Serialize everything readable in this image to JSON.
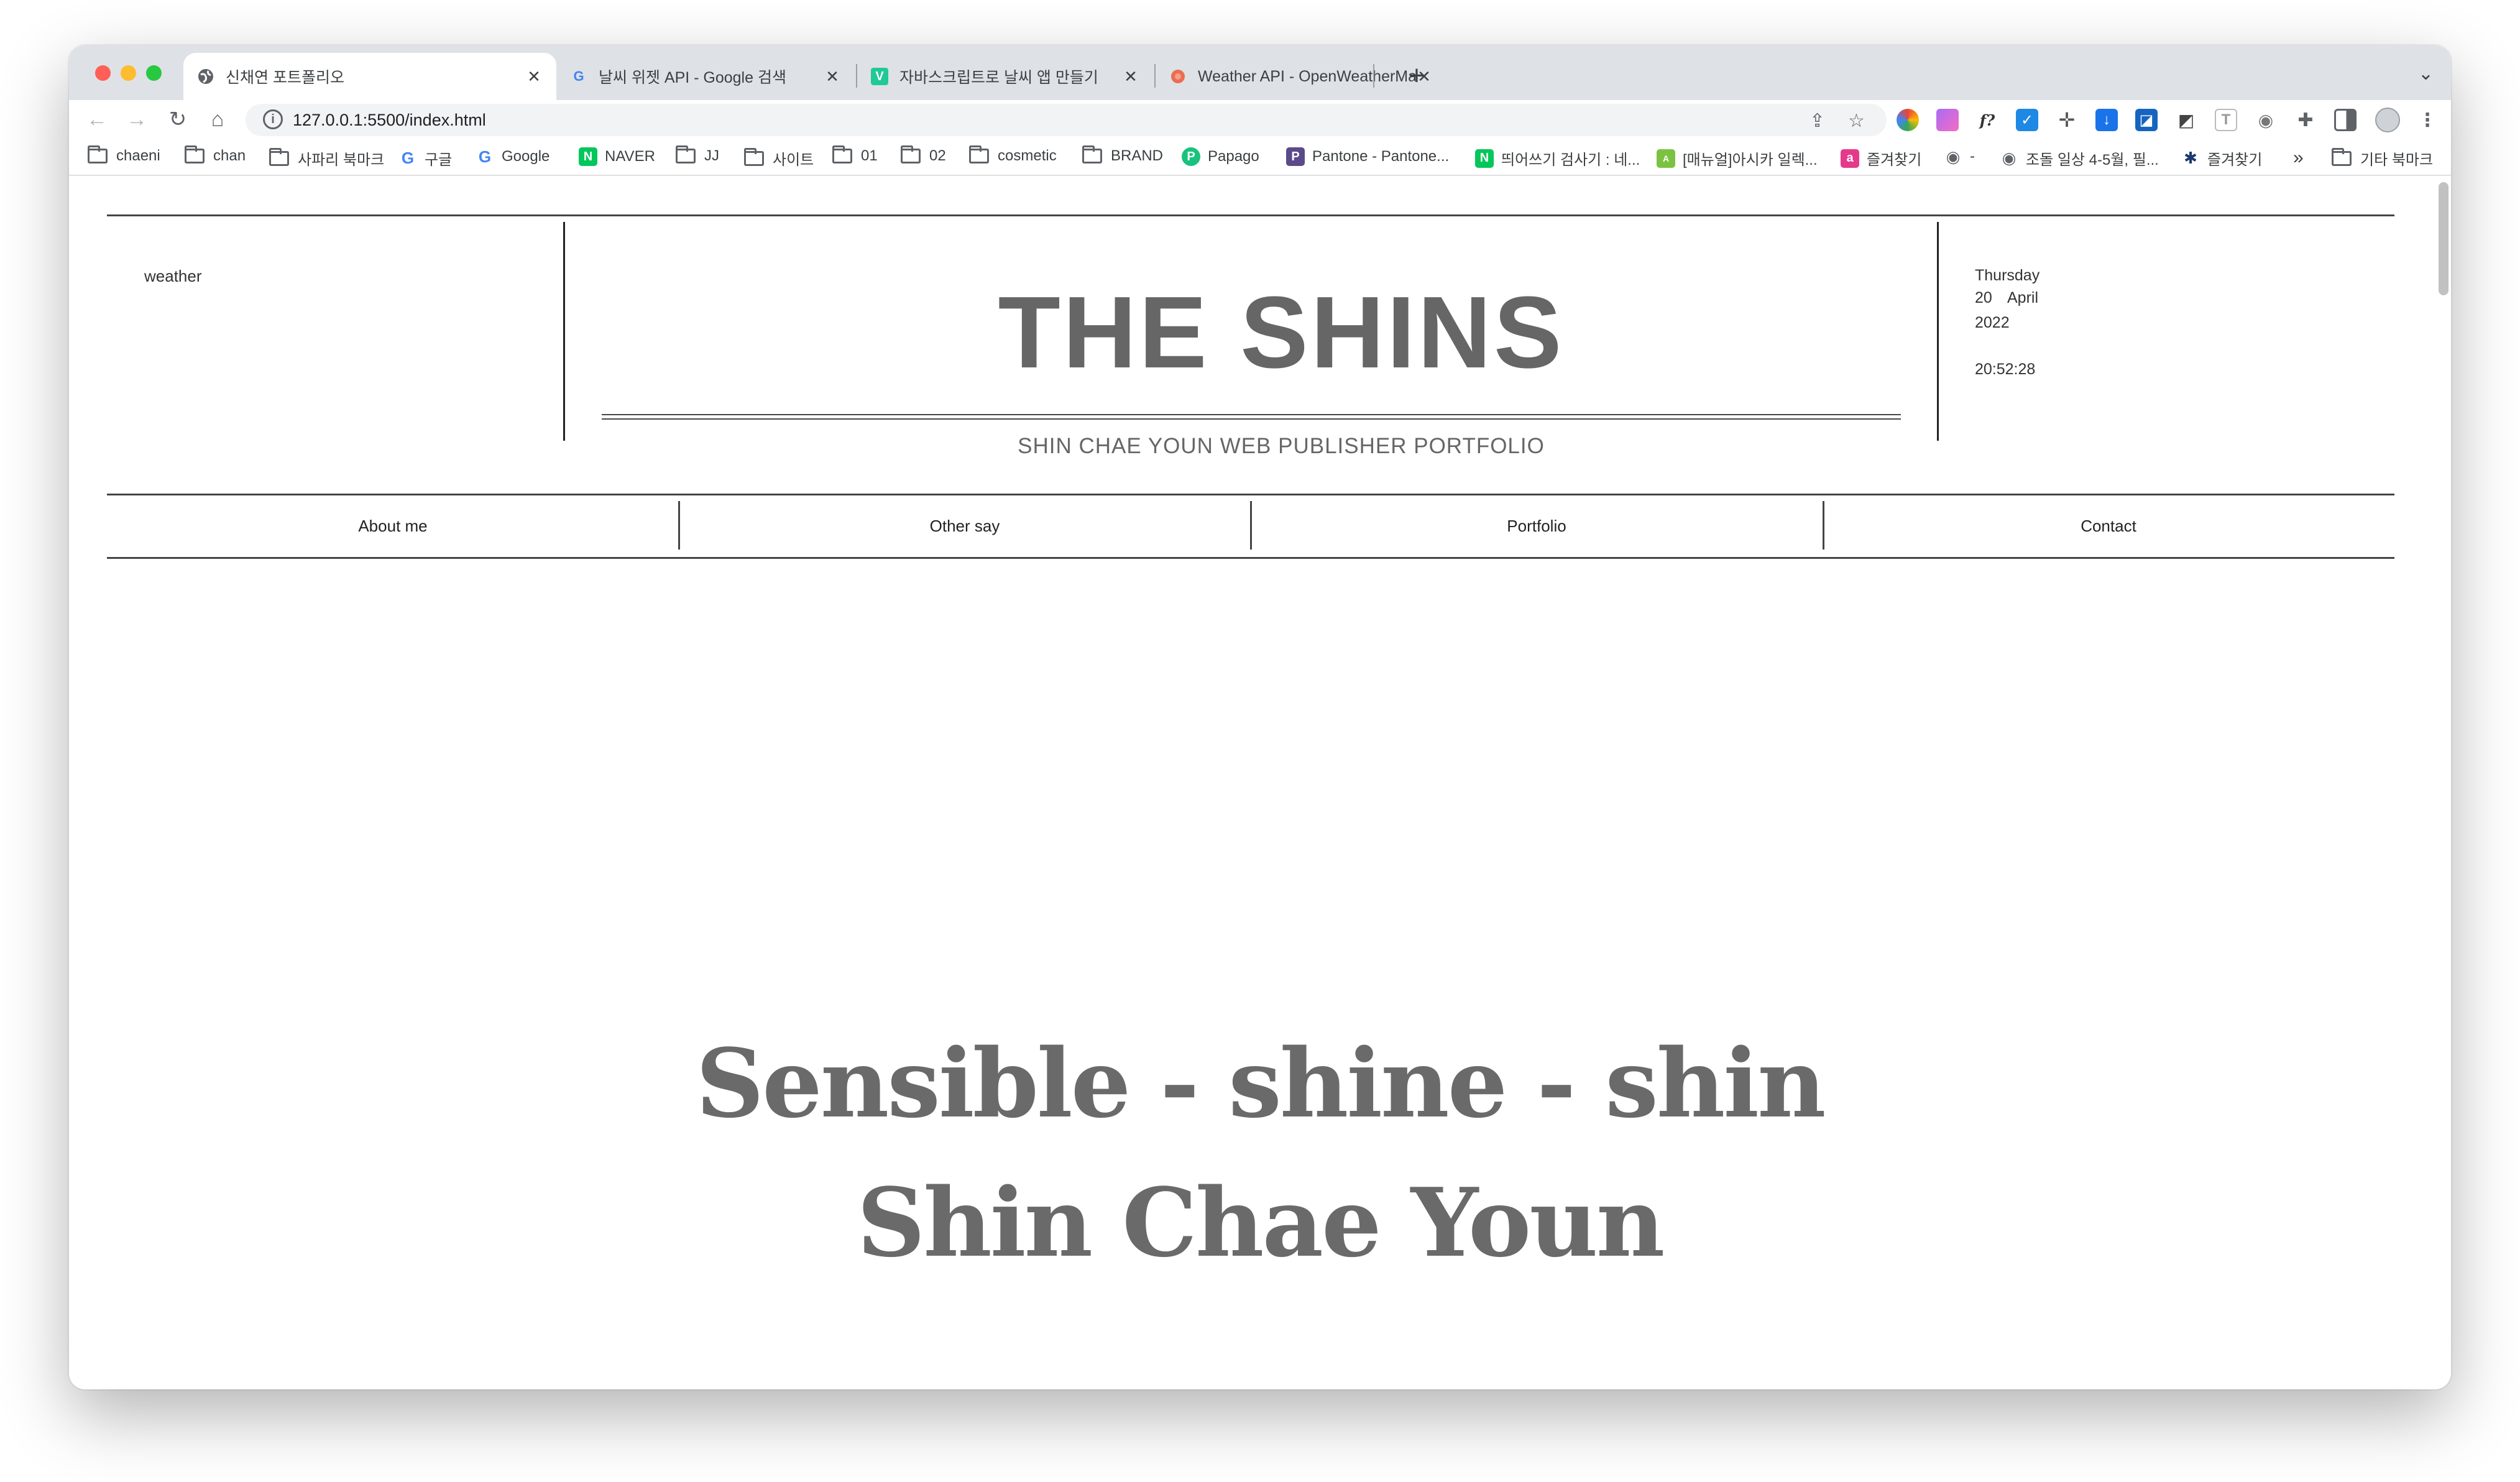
{
  "browser": {
    "tabs": [
      {
        "title": "신채연 포트폴리오",
        "icon": "globe-icon",
        "active": true
      },
      {
        "title": "날씨 위젯 API - Google 검색",
        "icon": "google-icon",
        "active": false
      },
      {
        "title": "자바스크립트로 날씨 앱 만들기",
        "icon": "velog-icon",
        "active": false
      },
      {
        "title": "Weather API - OpenWeatherMap",
        "icon": "openweather-icon",
        "active": false
      }
    ],
    "new_tab_label": "+",
    "url": "127.0.0.1:5500/index.html",
    "bookmarks": [
      {
        "label": "chaeni",
        "icon": "folder-icon"
      },
      {
        "label": "chan",
        "icon": "folder-icon"
      },
      {
        "label": "사파리 북마크",
        "icon": "folder-icon"
      },
      {
        "label": "구글",
        "icon": "google-icon"
      },
      {
        "label": "Google",
        "icon": "google-icon"
      },
      {
        "label": "NAVER",
        "icon": "naver-icon"
      },
      {
        "label": "JJ",
        "icon": "folder-icon"
      },
      {
        "label": "사이트",
        "icon": "folder-icon"
      },
      {
        "label": "01",
        "icon": "folder-icon"
      },
      {
        "label": "02",
        "icon": "folder-icon"
      },
      {
        "label": "cosmetic",
        "icon": "folder-icon"
      },
      {
        "label": "BRAND",
        "icon": "folder-icon"
      },
      {
        "label": "Papago",
        "icon": "papago-icon"
      },
      {
        "label": "Pantone - Pantone...",
        "icon": "pantone-icon"
      },
      {
        "label": "띄어쓰기 검사기 : 네...",
        "icon": "naver-icon"
      },
      {
        "label": "[매뉴얼]아시카 일렉...",
        "icon": "asica-icon"
      },
      {
        "label": "즐겨찾기",
        "icon": "bookmark-app-icon"
      },
      {
        "label": "-",
        "icon": "globe-icon"
      },
      {
        "label": "조돌 일상 4-5월, 필...",
        "icon": "globe-icon"
      },
      {
        "label": "즐겨찾기",
        "icon": "palm-icon"
      }
    ],
    "overflow_label": "»",
    "other_bookmarks": "기타 북마크"
  },
  "site": {
    "weather_label": "weather",
    "title": "THE SHINS",
    "subtitle": "SHIN CHAE YOUN WEB PUBLISHER PORTFOLIO",
    "date": {
      "weekday": "Thursday",
      "day": "20",
      "month": "April",
      "year": "2022",
      "time": "20:52:28"
    },
    "nav": [
      "About me",
      "Other say",
      "Portfolio",
      "Contact"
    ],
    "hero_line1": "Sensible - shine - shin",
    "hero_line2": "Shin Chae Youn"
  },
  "colors": {
    "close": "#ff5f57",
    "minimize": "#febc2e",
    "maximize": "#28c840",
    "headline": "#666666",
    "hero": "#6a6a6a"
  }
}
